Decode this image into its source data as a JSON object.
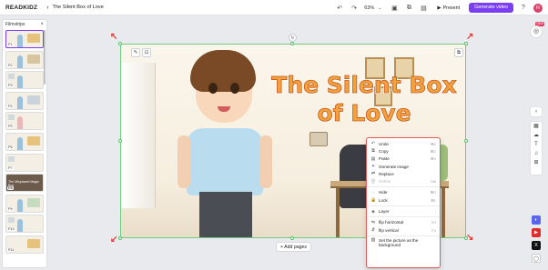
{
  "topbar": {
    "logo": "READKIDZ",
    "back_icon": "chevron-left-icon",
    "title": "The Silent Box of Love",
    "zoom": "63%",
    "present_label": "Present",
    "generate_label": "Generate video",
    "avatar_initial": "R"
  },
  "filmstrip": {
    "title": "Filmstrips",
    "pages": [
      "P1",
      "P2",
      "P3",
      "P4",
      "P5",
      "P6",
      "P7",
      "P8",
      "P9",
      "P10",
      "P11"
    ],
    "p8_text": "The Misplaced Magic Box"
  },
  "canvas": {
    "title_text": "The Silent Box of Love"
  },
  "add_pages_label": "+ Add pages",
  "context_menu": {
    "items": [
      {
        "icon": "undo-icon",
        "label": "Undo",
        "shortcut": "⌘Z"
      },
      {
        "icon": "copy-icon",
        "label": "Copy",
        "shortcut": "⌘C"
      },
      {
        "icon": "paste-icon",
        "label": "Paste",
        "shortcut": "⌘V"
      },
      {
        "icon": "sparkle-icon",
        "label": "Generate image",
        "shortcut": ""
      },
      {
        "icon": "replace-icon",
        "label": "Replace",
        "shortcut": ""
      },
      {
        "icon": "trash-icon",
        "label": "Delete",
        "shortcut": "Del"
      },
      {
        "icon": "eye-off-icon",
        "label": "Hide",
        "shortcut": "⌘H"
      },
      {
        "icon": "lock-icon",
        "label": "Lock",
        "shortcut": "⌘L"
      },
      {
        "icon": "layers-icon",
        "label": "Layer",
        "shortcut": "›"
      },
      {
        "icon": "flip-h-icon",
        "label": "flip horizontal",
        "shortcut": "⇧H"
      },
      {
        "icon": "flip-v-icon",
        "label": "flip vertical",
        "shortcut": "⇧V"
      },
      {
        "icon": "background-icon",
        "label": "Set the picture as the background",
        "shortcut": ""
      }
    ]
  },
  "badge_new": "NEW",
  "colors": {
    "accent": "#7b3ff2",
    "selection": "#56c06a",
    "arrow": "#e23b3b"
  }
}
